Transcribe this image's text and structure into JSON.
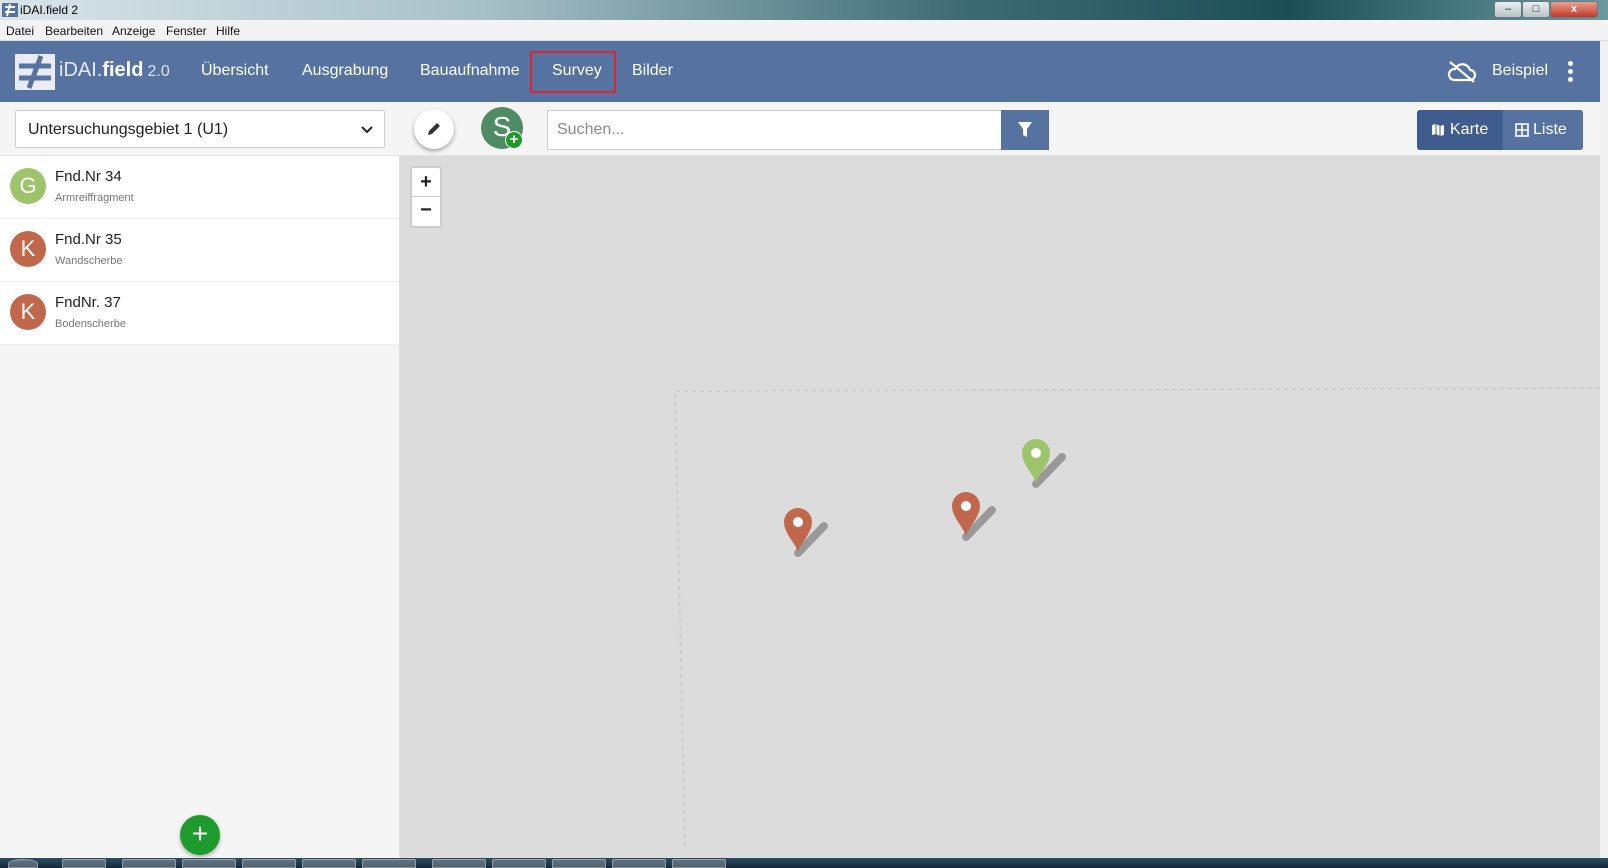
{
  "window": {
    "title": "iDAI.field 2",
    "minimize_glyph": "–",
    "maximize_glyph": "□",
    "close_glyph": "x"
  },
  "menubar": {
    "items": [
      "Datei",
      "Bearbeiten",
      "Anzeige",
      "Fenster",
      "Hilfe"
    ]
  },
  "navbar": {
    "app_name_light": "iDAI.",
    "app_name_bold": "field",
    "app_version": "2.0",
    "tabs": [
      "Übersicht",
      "Ausgrabung",
      "Bauaufnahme",
      "Survey",
      "Bilder"
    ],
    "active_tab": "Survey",
    "project_name": "Beispiel",
    "sync_icon": "cloud-off-icon"
  },
  "toolbar": {
    "operation_select_value": "Untersuchungsgebiet 1 (U1)",
    "add_operation_letter": "S",
    "search_placeholder": "Suchen...",
    "view_map_label": "Karte",
    "view_list_label": "Liste",
    "active_view": "Karte"
  },
  "resources": [
    {
      "avatar_letter": "G",
      "identifier": "Fnd.Nr 34",
      "short_description": "Armreiffragment",
      "color": "#9dc36b"
    },
    {
      "avatar_letter": "K",
      "identifier": "Fnd.Nr 35",
      "short_description": "Wandscherbe",
      "color": "#c0674c"
    },
    {
      "avatar_letter": "K",
      "identifier": "FndNr. 37",
      "short_description": "Bodenscherbe",
      "color": "#c0674c"
    }
  ],
  "map": {
    "zoom_in_label": "+",
    "zoom_out_label": "−",
    "markers": [
      {
        "color": "#9dc36b",
        "resource": "Fnd.Nr 34"
      },
      {
        "color": "#c0674c",
        "resource": "Fnd.Nr 35"
      },
      {
        "color": "#c0674c",
        "resource": "FndNr. 37"
      }
    ]
  },
  "colors": {
    "navbar": "#5572a0",
    "accent_green": "#1e9b2c",
    "highlight_border": "#e3232a"
  }
}
